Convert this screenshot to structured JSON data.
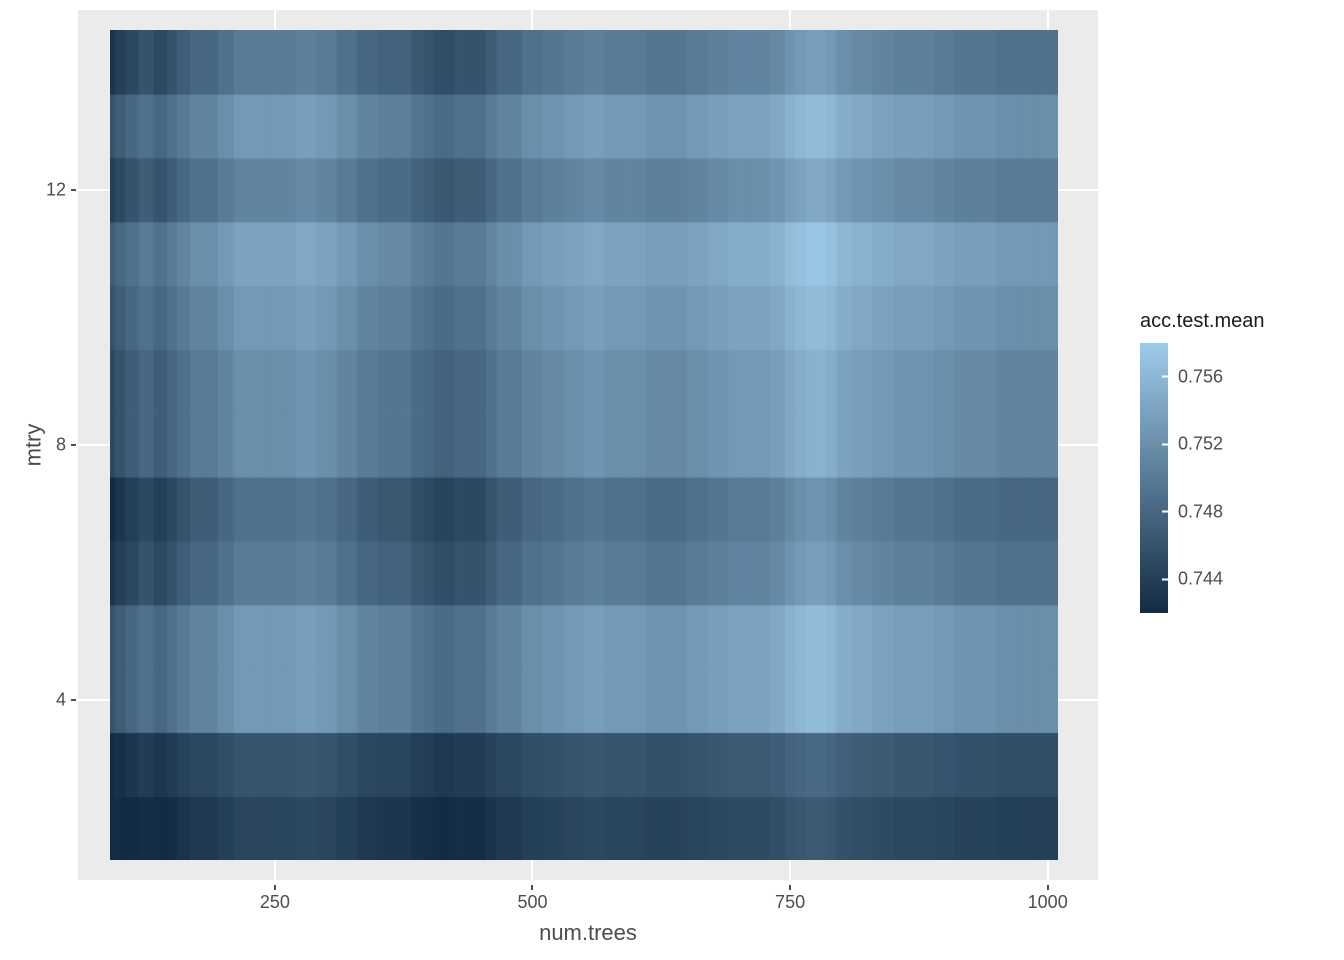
{
  "chart_data": {
    "type": "heatmap",
    "xlabel": "num.trees",
    "ylabel": "mtry",
    "legend_title": "acc.test.mean",
    "x_ticks": [
      250,
      500,
      750,
      1000
    ],
    "y_ticks": [
      4,
      8,
      12
    ],
    "x_range": [
      90,
      1010
    ],
    "y_range": [
      1.5,
      14.5
    ],
    "cmin": 0.742,
    "cmax": 0.758,
    "legend_stops": [
      0.744,
      0.748,
      0.752,
      0.756
    ],
    "color_lo": "#132B43",
    "color_hi": "#9ECBEA",
    "xvals": [
      90,
      100,
      110,
      125,
      140,
      150,
      160,
      175,
      190,
      200,
      220,
      240,
      250,
      260,
      280,
      300,
      320,
      340,
      360,
      375,
      390,
      400,
      410,
      420,
      430,
      440,
      450,
      460,
      470,
      480,
      500,
      520,
      540,
      560,
      580,
      600,
      620,
      640,
      660,
      680,
      700,
      720,
      740,
      750,
      760,
      770,
      780,
      790,
      800,
      820,
      840,
      860,
      880,
      900,
      920,
      940,
      960,
      980,
      1000,
      1010
    ],
    "yvals": [
      2,
      3,
      4,
      5,
      6,
      7,
      8,
      9,
      10,
      11,
      12,
      13,
      14
    ],
    "row_baselines": {
      "2": 0.744,
      "3": 0.7455,
      "4": 0.752,
      "5": 0.752,
      "6": 0.749,
      "7": 0.748,
      "8": 0.751,
      "9": 0.751,
      "10": 0.752,
      "11": 0.753,
      "12": 0.75,
      "13": 0.752,
      "14": 0.749
    },
    "x_modulation": [
      [
        90,
        -0.006
      ],
      [
        100,
        -0.005
      ],
      [
        110,
        -0.004
      ],
      [
        125,
        -0.003
      ],
      [
        140,
        -0.004
      ],
      [
        150,
        -0.003
      ],
      [
        160,
        -0.002
      ],
      [
        175,
        -0.001
      ],
      [
        190,
        -0.001
      ],
      [
        200,
        0.0
      ],
      [
        220,
        0.001
      ],
      [
        240,
        0.001
      ],
      [
        250,
        0.001
      ],
      [
        260,
        0.001
      ],
      [
        280,
        0.0015
      ],
      [
        300,
        0.001
      ],
      [
        320,
        0.0
      ],
      [
        340,
        -0.001
      ],
      [
        360,
        -0.0015
      ],
      [
        375,
        -0.0015
      ],
      [
        390,
        -0.0025
      ],
      [
        400,
        -0.003
      ],
      [
        410,
        -0.0035
      ],
      [
        420,
        -0.0035
      ],
      [
        430,
        -0.003
      ],
      [
        440,
        -0.003
      ],
      [
        450,
        -0.003
      ],
      [
        460,
        -0.002
      ],
      [
        470,
        -0.001
      ],
      [
        480,
        -0.001
      ],
      [
        500,
        0.0
      ],
      [
        520,
        0.0005
      ],
      [
        540,
        0.001
      ],
      [
        560,
        0.0015
      ],
      [
        580,
        0.001
      ],
      [
        600,
        0.001
      ],
      [
        620,
        0.0005
      ],
      [
        640,
        0.0005
      ],
      [
        660,
        0.001
      ],
      [
        680,
        0.0015
      ],
      [
        700,
        0.002
      ],
      [
        720,
        0.002
      ],
      [
        740,
        0.0025
      ],
      [
        750,
        0.0035
      ],
      [
        760,
        0.004
      ],
      [
        770,
        0.0045
      ],
      [
        780,
        0.0045
      ],
      [
        790,
        0.004
      ],
      [
        800,
        0.003
      ],
      [
        820,
        0.0025
      ],
      [
        840,
        0.002
      ],
      [
        860,
        0.0015
      ],
      [
        880,
        0.0015
      ],
      [
        900,
        0.001
      ],
      [
        920,
        0.0005
      ],
      [
        940,
        0.0005
      ],
      [
        960,
        0.0
      ],
      [
        980,
        0.0
      ],
      [
        1000,
        0.0
      ],
      [
        1010,
        0.0
      ]
    ]
  }
}
